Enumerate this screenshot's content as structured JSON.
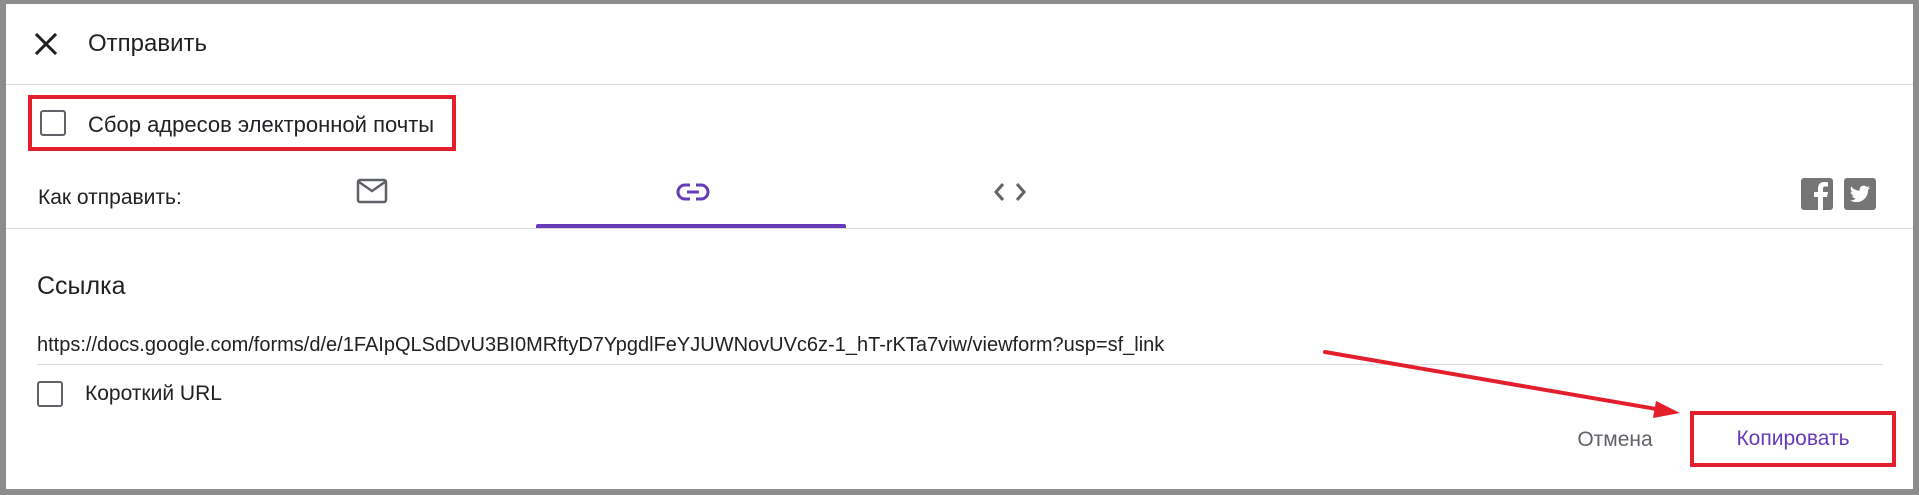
{
  "dialog": {
    "title": "Отправить",
    "close_icon": "close-icon"
  },
  "collect_emails": {
    "label": "Сбор адресов электронной почты",
    "checked": false
  },
  "send_via": {
    "label": "Как отправить:",
    "tabs": [
      {
        "icon": "email-icon",
        "selected": false
      },
      {
        "icon": "link-icon",
        "selected": true
      },
      {
        "icon": "embed-code-icon",
        "selected": false
      }
    ],
    "share_icons": [
      "facebook-icon",
      "twitter-icon"
    ]
  },
  "link_section": {
    "title": "Ссылка",
    "url": "https://docs.google.com/forms/d/e/1FAIpQLSdDvU3BI0MRftyD7YpgdlFeYJUWNovUVc6z-1_hT-rKTa7viw/viewform?usp=sf_link",
    "short_url_label": "Короткий URL",
    "short_url_checked": false
  },
  "actions": {
    "cancel_label": "Отмена",
    "copy_label": "Копировать"
  },
  "colors": {
    "accent": "#673ab7",
    "annotation_red": "#e31e2d",
    "icon_gray": "#5f6368"
  }
}
